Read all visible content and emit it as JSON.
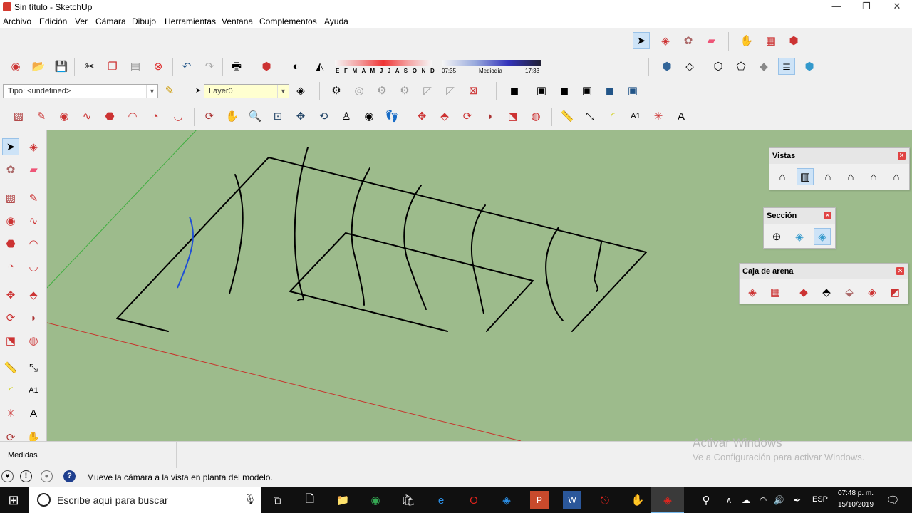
{
  "window": {
    "title": "Sin título - SketchUp"
  },
  "menu": [
    "Archivo",
    "Edición",
    "Ver",
    "Cámara",
    "Dibujo",
    "Herramientas",
    "Ventana",
    "Complementos",
    "Ayuda"
  ],
  "shadow": {
    "months": "E F M A M J J A S O N D",
    "time_start": "07:35",
    "time_mid": "Mediodía",
    "time_end": "17:33"
  },
  "attributes": {
    "tipo": "Tipo: <undefined>",
    "layer": "Layer0"
  },
  "panels": {
    "vistas": {
      "title": "Vistas"
    },
    "seccion": {
      "title": "Sección"
    },
    "sandbox": {
      "title": "Caja de arena"
    }
  },
  "measure": {
    "label": "Medidas"
  },
  "status": {
    "message": "Mueve la cámara a la vista en planta del modelo."
  },
  "watermark": {
    "line1": "Activar Windows",
    "line2": "Ve a Configuración para activar Windows."
  },
  "taskbar": {
    "search_placeholder": "Escribe aquí para buscar",
    "lang": "ESP",
    "time": "07:48 p. m.",
    "date": "15/10/2019"
  },
  "colors": {
    "viewport": "#9dbb8c",
    "axis_green": "#3fae3f",
    "axis_red": "#c8322a",
    "selected_blue": "#1f4fd6"
  }
}
